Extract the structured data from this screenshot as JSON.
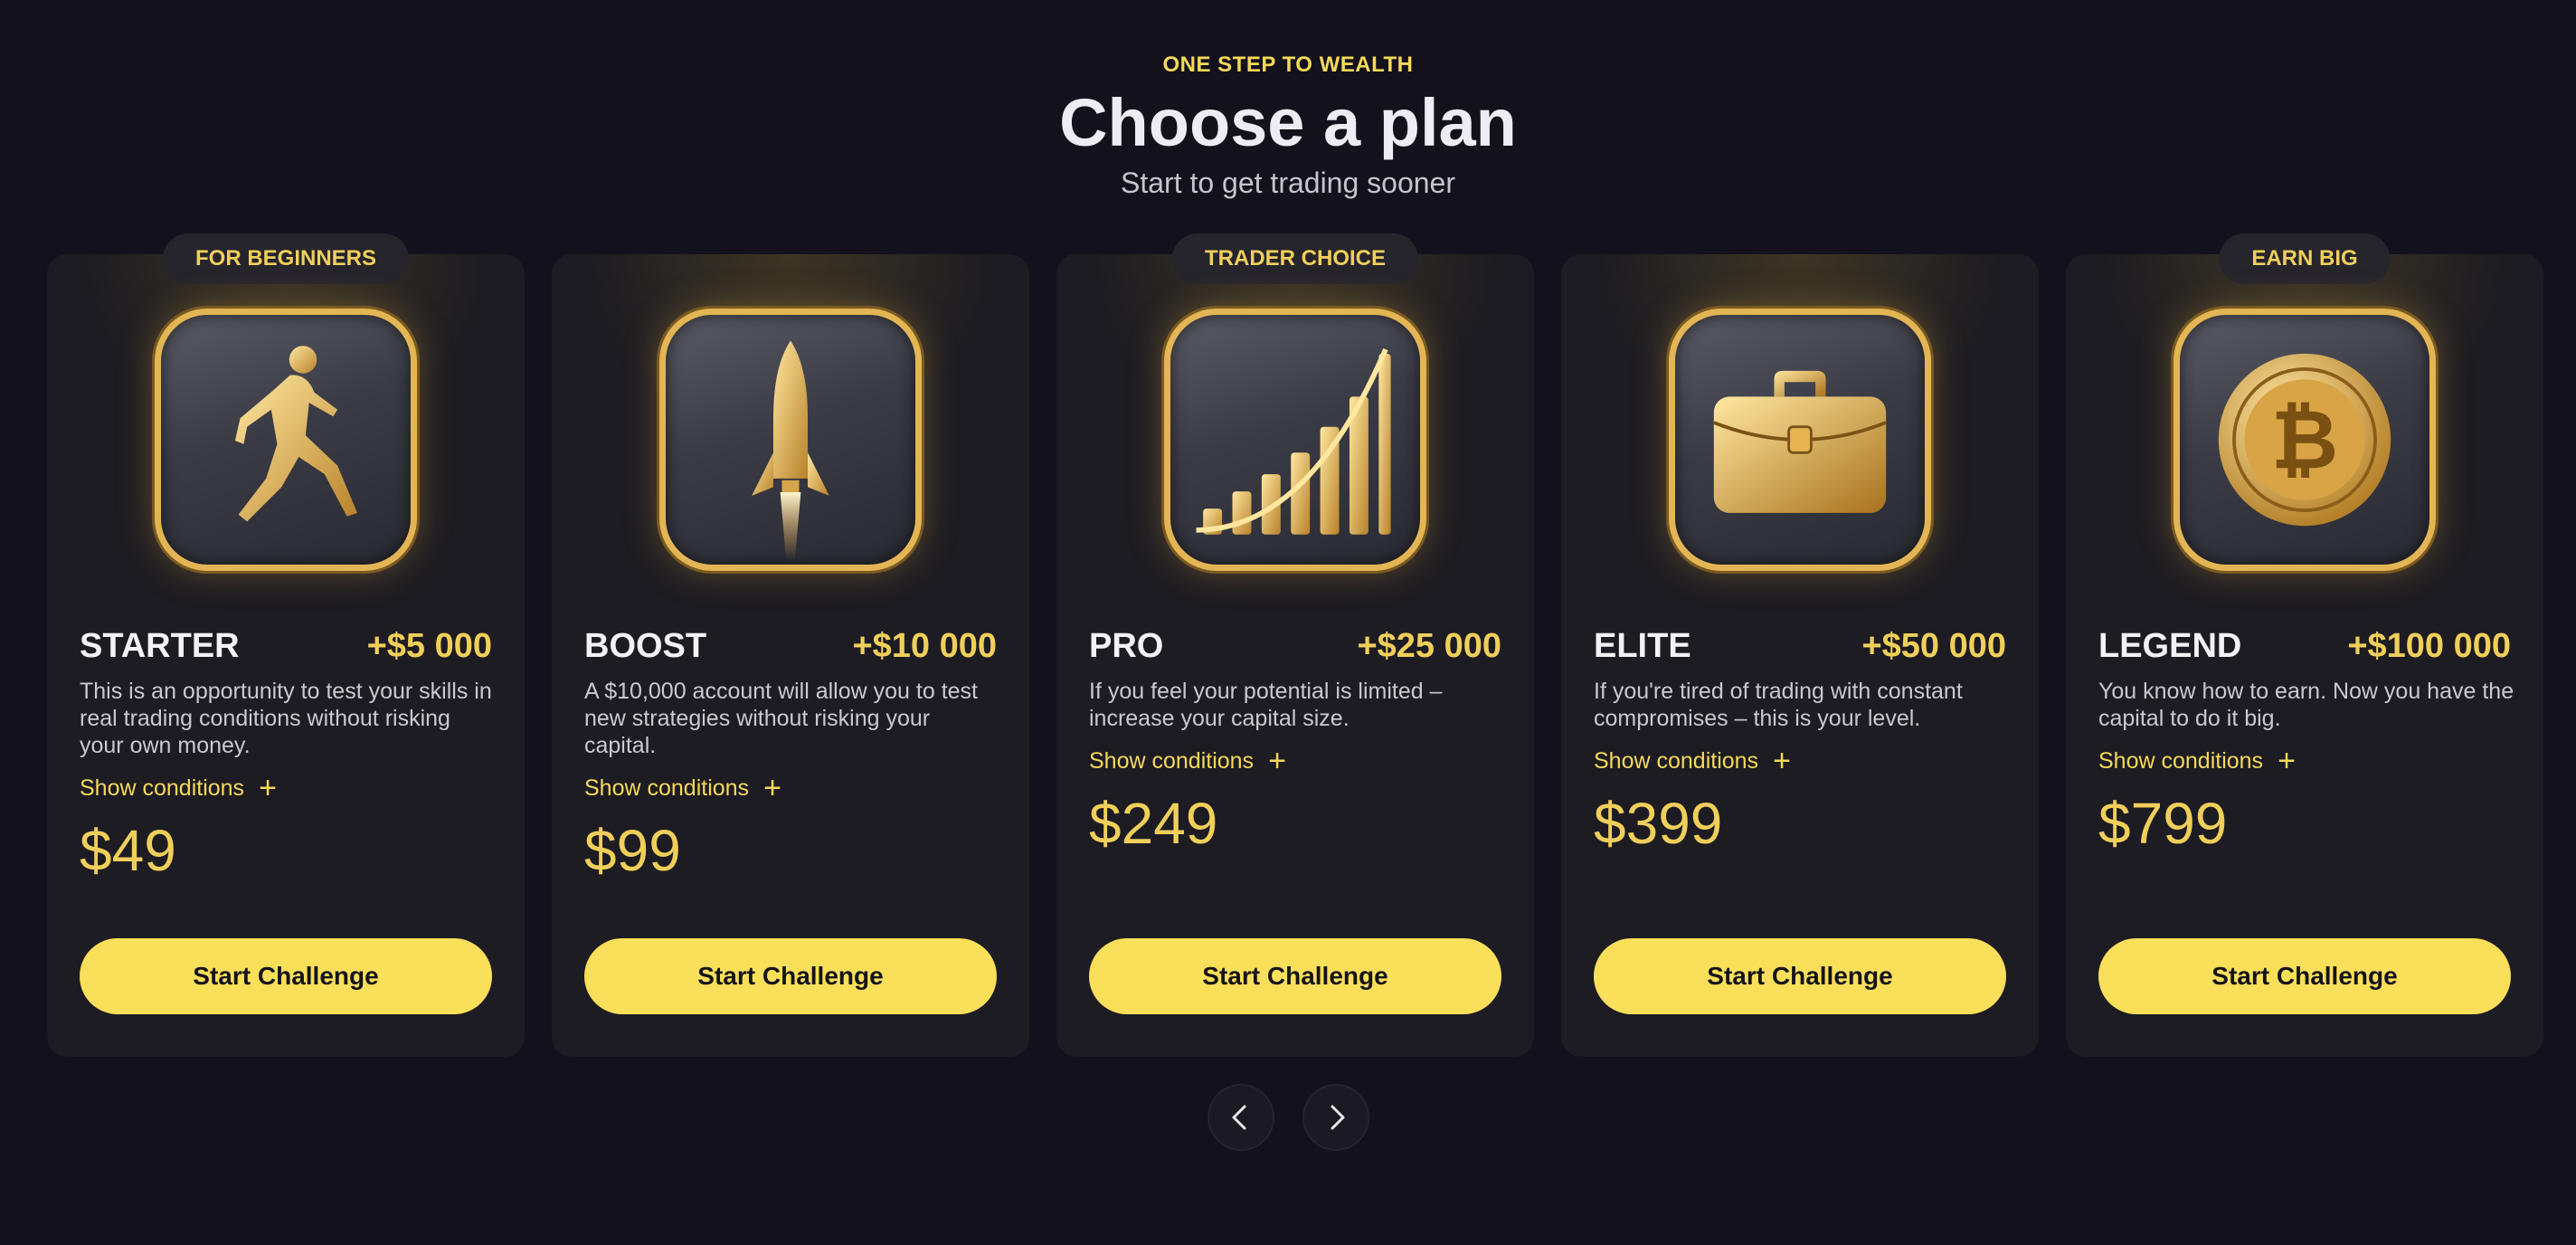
{
  "header": {
    "eyebrow": "ONE STEP TO WEALTH",
    "title": "Choose a plan",
    "subtitle": "Start to get trading sooner"
  },
  "plans": [
    {
      "tag": "FOR BEGINNERS",
      "name": "STARTER",
      "amount": "+$5 000",
      "description": "This is an opportunity to test your skills in real trading conditions without risking your own money.",
      "show_conditions": "Show conditions",
      "price": "$49",
      "button": "Start Challenge",
      "icon": "runner-icon"
    },
    {
      "tag": "",
      "name": "BOOST",
      "amount": "+$10 000",
      "description": "A $10,000 account will allow you to test new strategies without risking your capital.",
      "show_conditions": "Show conditions",
      "price": "$99",
      "button": "Start Challenge",
      "icon": "rocket-icon"
    },
    {
      "tag": "TRADER CHOICE",
      "name": "PRO",
      "amount": "+$25 000",
      "description": "If you feel your potential is limited – increase your capital size.",
      "show_conditions": "Show conditions",
      "price": "$249",
      "button": "Start Challenge",
      "icon": "growth-chart-icon"
    },
    {
      "tag": "",
      "name": "ELITE",
      "amount": "+$50 000",
      "description": "If you're tired of trading with constant compromises – this is your level.",
      "show_conditions": "Show conditions",
      "price": "$399",
      "button": "Start Challenge",
      "icon": "briefcase-icon"
    },
    {
      "tag": "EARN BIG",
      "name": "LEGEND",
      "amount": "+$100 000",
      "description": "You know how to earn. Now you have the capital to do it big.",
      "show_conditions": "Show conditions",
      "price": "$799",
      "button": "Start Challenge",
      "icon": "bitcoin-icon"
    }
  ],
  "pager": {
    "prev_icon": "chevron-left-icon",
    "next_icon": "chevron-right-icon"
  },
  "colors": {
    "background": "#13121c",
    "card": "#1d1c22",
    "accent": "#fadf5a",
    "gold": "#f0cf5a"
  }
}
